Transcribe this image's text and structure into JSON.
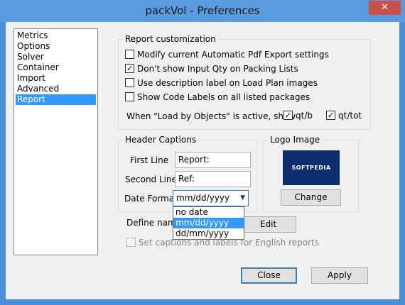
{
  "window": {
    "title": "packVol - Preferences",
    "close_glyph": "✕"
  },
  "nav": {
    "items": [
      "Metrics",
      "Options",
      "Solver",
      "Container",
      "Import",
      "Advanced",
      "Report"
    ],
    "selected": "Report"
  },
  "report_customization": {
    "title": "Report customization",
    "options": [
      {
        "label": "Modify current Automatic Pdf Export settings",
        "checked": false
      },
      {
        "label": "Don't show Input Qty on Packing Lists",
        "checked": true
      },
      {
        "label": "Use description label on Load Plan images",
        "checked": false
      },
      {
        "label": "Show Code Labels on all listed packages",
        "checked": false
      }
    ],
    "load_by_objects_label": "When \"Load by Objects\" is active, show",
    "qtb": {
      "label": "qt/b",
      "checked": true
    },
    "qttot": {
      "label": "qt/tot",
      "checked": true
    }
  },
  "header_captions": {
    "title": "Header Captions",
    "first_line_label": "First Line",
    "first_line_value": "Report:",
    "second_line_label": "Second Line",
    "second_line_value": "Ref:",
    "date_format_label": "Date Format",
    "date_format_value": "mm/dd/yyyy",
    "date_format_options": [
      "no date",
      "mm/dd/yyyy",
      "dd/mm/yyyy"
    ],
    "date_format_highlighted": "mm/dd/yyyy"
  },
  "logo": {
    "title": "Logo Image",
    "logo_text": "SOFTPEDIA",
    "change_label": "Change"
  },
  "define_names": {
    "label": "Define name",
    "edit_label": "Edit"
  },
  "english_reports": {
    "label": "Set captions and labels for English reports",
    "checked": false,
    "disabled": true
  },
  "buttons": {
    "close": "Close",
    "apply": "Apply"
  },
  "colors": {
    "titlebar": "#5a9be0",
    "selection": "#3399ff",
    "close_button": "#c7504a",
    "logo_bg": "#0c2c6e"
  }
}
